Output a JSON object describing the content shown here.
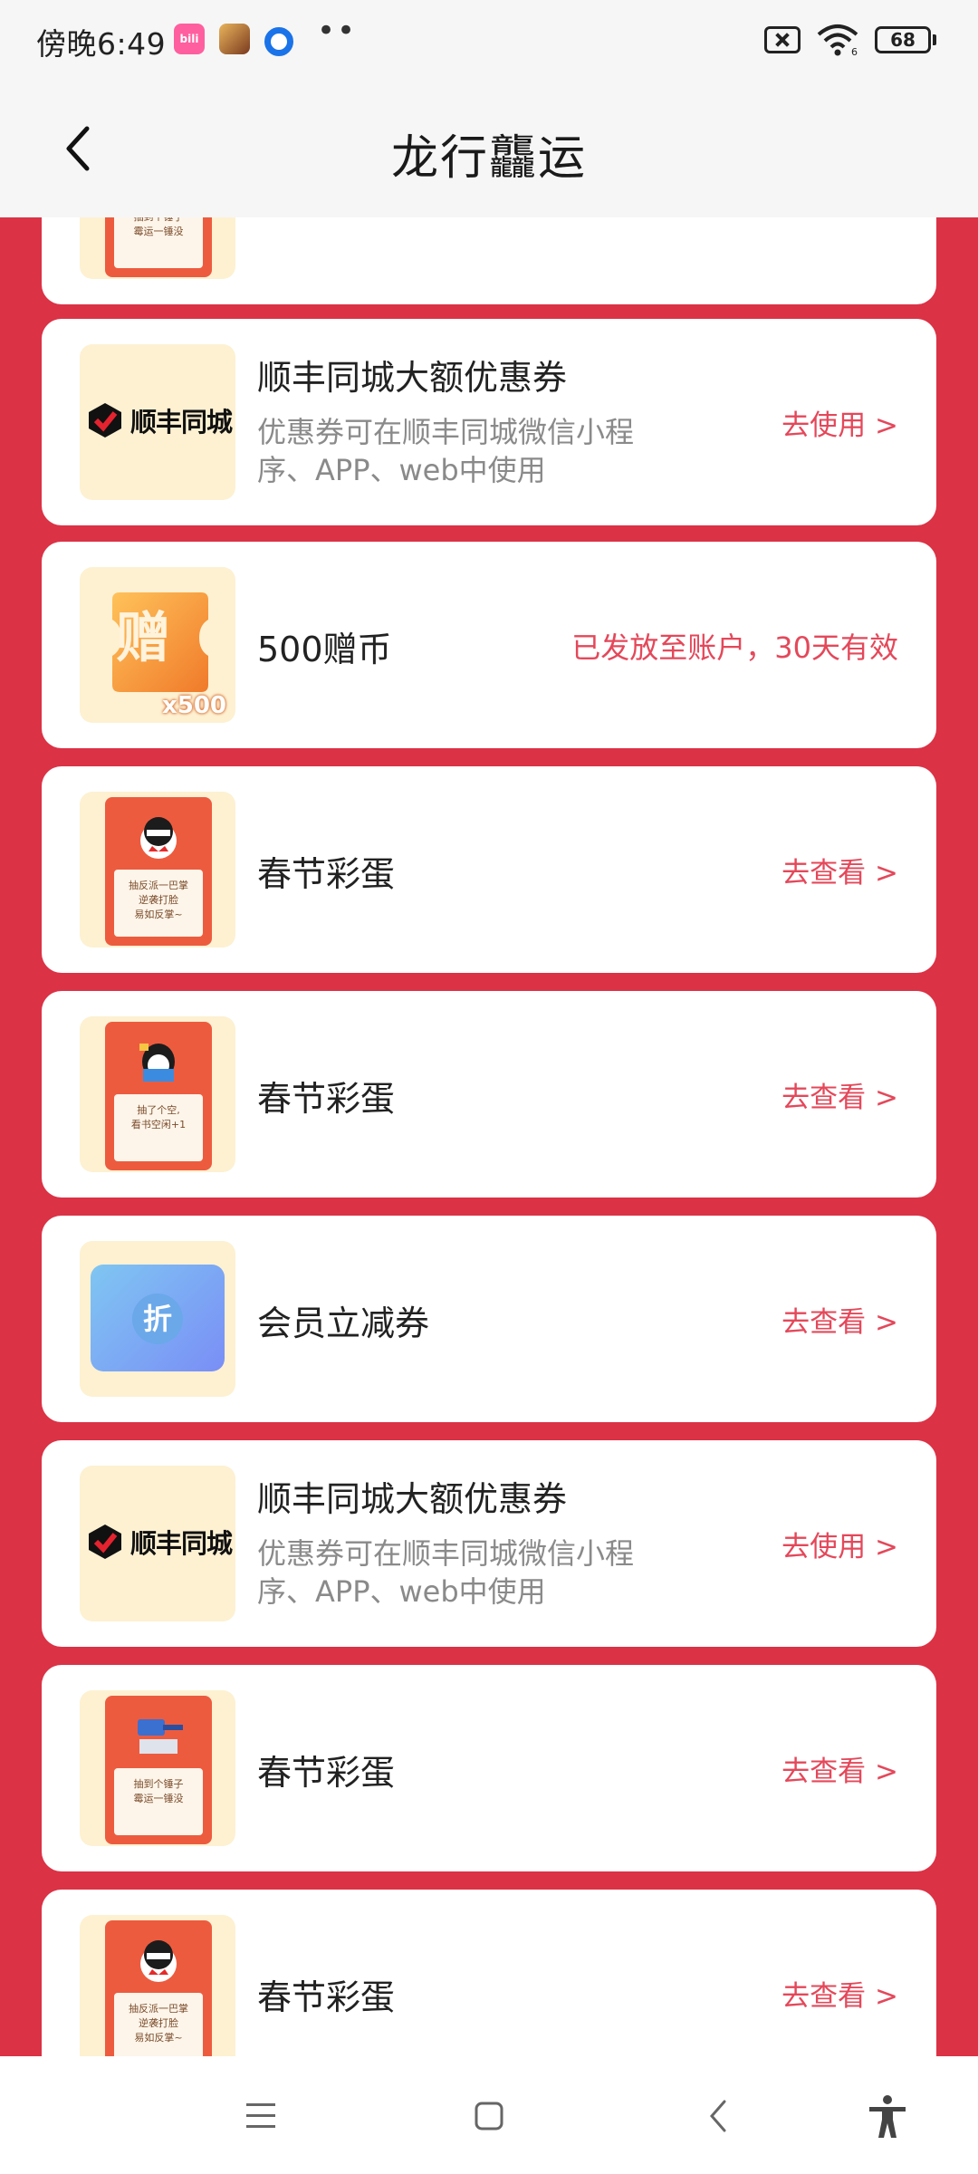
{
  "status_bar": {
    "time": "傍晚6:49",
    "battery": "68",
    "app_icons": [
      "bilibili-icon",
      "game-icon",
      "qq-browser-icon"
    ],
    "more": "••",
    "wifi_label": "6"
  },
  "header": {
    "title": "龙行龘运"
  },
  "cards": [
    {
      "kind": "egg",
      "title": "",
      "thumb_text": "抽到个锤子\n霉运一锤没",
      "action": ""
    },
    {
      "kind": "coupon",
      "title": "顺丰同城大额优惠券",
      "desc": "优惠券可在顺丰同城微信小程序、APP、web中使用",
      "logo_text": "顺丰同城",
      "action": "去使用 >"
    },
    {
      "kind": "coin",
      "title": "500赠币",
      "thumb_char": "赠",
      "thumb_count": "x500",
      "status": "已发放至账户，30天有效"
    },
    {
      "kind": "egg",
      "title": "春节彩蛋",
      "thumb_text": "抽反派一巴掌\n逆袭打脸\n易如反掌~",
      "action": "去查看 >"
    },
    {
      "kind": "egg",
      "title": "春节彩蛋",
      "thumb_text": "抽了个空,\n看书空闲+1",
      "action": "去查看 >"
    },
    {
      "kind": "discount",
      "title": "会员立减券",
      "thumb_char": "折",
      "action": "去查看 >"
    },
    {
      "kind": "coupon",
      "title": "顺丰同城大额优惠券",
      "desc": "优惠券可在顺丰同城微信小程序、APP、web中使用",
      "logo_text": "顺丰同城",
      "action": "去使用 >"
    },
    {
      "kind": "egg",
      "title": "春节彩蛋",
      "thumb_text": "抽到个锤子\n霉运一锤没",
      "action": "去查看 >"
    },
    {
      "kind": "egg",
      "title": "春节彩蛋",
      "thumb_text": "抽反派一巴掌\n逆袭打脸\n易如反掌~",
      "action": "去查看 >"
    }
  ],
  "colors": {
    "page_red": "#db3246",
    "accent": "#e4485a",
    "thumb_bg": "#fdf1d2"
  },
  "system_nav": [
    "menu-icon",
    "home-icon",
    "back-icon",
    "accessibility-icon"
  ]
}
